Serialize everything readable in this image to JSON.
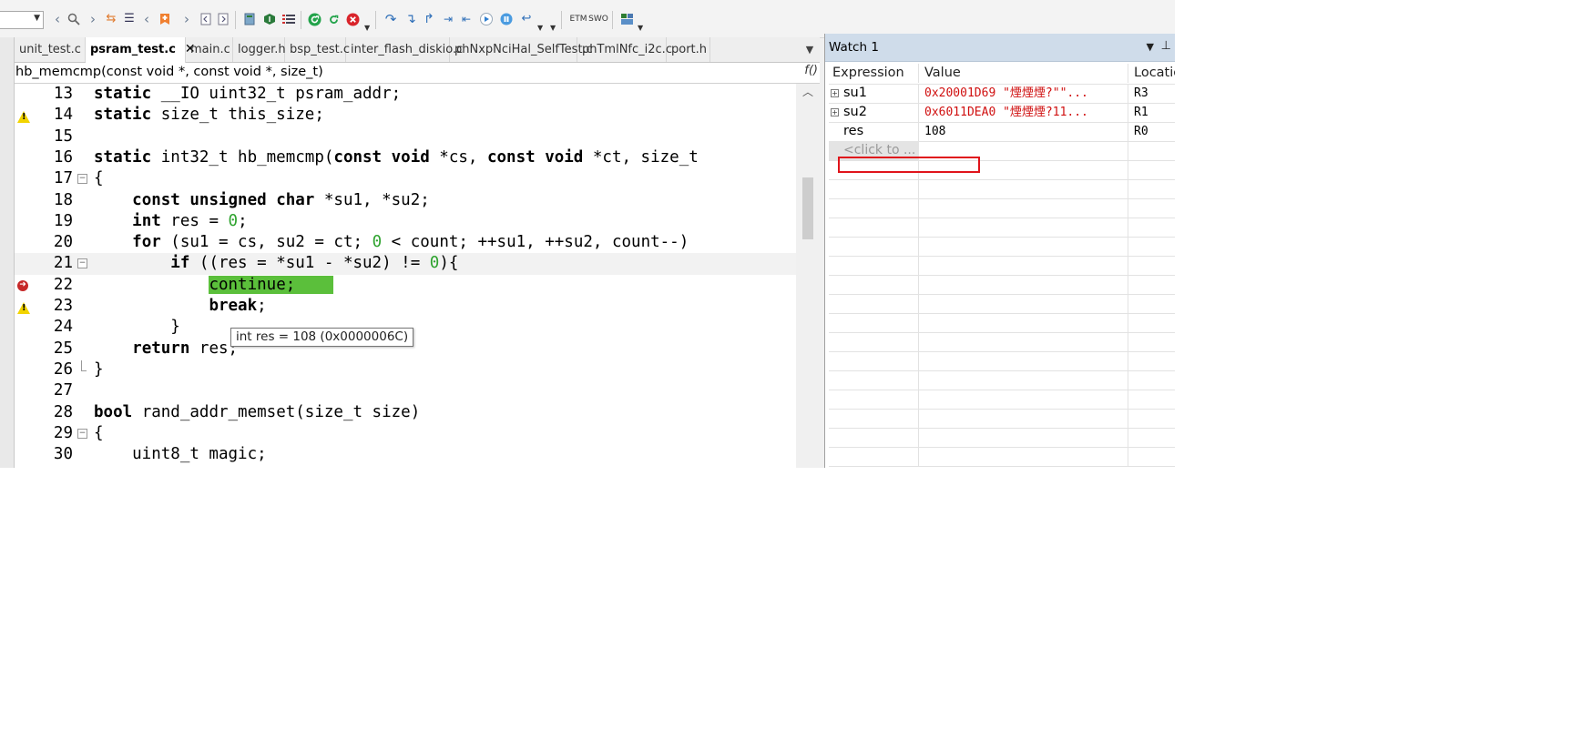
{
  "toolbar": {
    "etm_label": "ETM",
    "swo_label": "SWO",
    "icons": [
      "back-icon",
      "find-icon",
      "forward-icon",
      "toggle-icon",
      "indent-icon",
      "back-small-icon",
      "bookmark-icon",
      "forward-small-icon",
      "prev-page-icon",
      "next-page-icon",
      "download-icon",
      "flash-icon",
      "list-icon",
      "run-icon",
      "reset-icon",
      "stop-icon",
      "step-over-icon",
      "step-into-icon",
      "step-out-icon",
      "run-to-cursor-icon",
      "show-next-icon",
      "play-icon",
      "pause-icon",
      "return-icon",
      "window-icon"
    ]
  },
  "editor": {
    "tabs": [
      {
        "label": "unit_test.c",
        "active": false
      },
      {
        "label": "psram_test.c",
        "active": true
      },
      {
        "label": "main.c",
        "active": false
      },
      {
        "label": "logger.h",
        "active": false
      },
      {
        "label": "bsp_test.c",
        "active": false
      },
      {
        "label": "inter_flash_diskio.c",
        "active": false
      },
      {
        "label": "phNxpNciHal_SelfTest.c",
        "active": false
      },
      {
        "label": "phTmlNfc_i2c.c",
        "active": false
      },
      {
        "label": "port.h",
        "active": false
      }
    ],
    "close_glyph": "✕",
    "function_signature": "hb_memcmp(const void *, const void *, size_t)",
    "func_icon": "f()",
    "lines": [
      {
        "num": "13",
        "gutter": ""
      },
      {
        "num": "14",
        "gutter": "warning"
      },
      {
        "num": "15",
        "gutter": ""
      },
      {
        "num": "16",
        "gutter": ""
      },
      {
        "num": "17",
        "gutter": ""
      },
      {
        "num": "18",
        "gutter": ""
      },
      {
        "num": "19",
        "gutter": ""
      },
      {
        "num": "20",
        "gutter": ""
      },
      {
        "num": "21",
        "gutter": ""
      },
      {
        "num": "22",
        "gutter": "exec"
      },
      {
        "num": "23",
        "gutter": "warning"
      },
      {
        "num": "24",
        "gutter": ""
      },
      {
        "num": "25",
        "gutter": ""
      },
      {
        "num": "26",
        "gutter": ""
      },
      {
        "num": "27",
        "gutter": ""
      },
      {
        "num": "28",
        "gutter": ""
      },
      {
        "num": "29",
        "gutter": ""
      },
      {
        "num": "30",
        "gutter": ""
      }
    ],
    "tooltip": "int res = 108 (0x0000006C)"
  },
  "watch": {
    "title": "Watch 1",
    "columns": [
      "Expression",
      "Value",
      "Location"
    ],
    "rows": [
      {
        "expression": "su1",
        "value": "0x20001D69 \"煙煙煙?\"\"...",
        "location": "R3",
        "expandable": true,
        "value_color": "#d01010"
      },
      {
        "expression": "su2",
        "value": "0x6011DEA0 \"煙煙煙?11...",
        "location": "R1",
        "expandable": true,
        "value_color": "#d01010"
      },
      {
        "expression": "res",
        "value": "108",
        "location": "R0",
        "expandable": false,
        "value_color": "#000000"
      }
    ],
    "add_placeholder": "<click to ..."
  },
  "colors": {
    "highlight_green": "#5bbf3b",
    "watch_value_red": "#d01010",
    "annotation_red": "#e0141b",
    "number_green": "#2ea32e"
  }
}
